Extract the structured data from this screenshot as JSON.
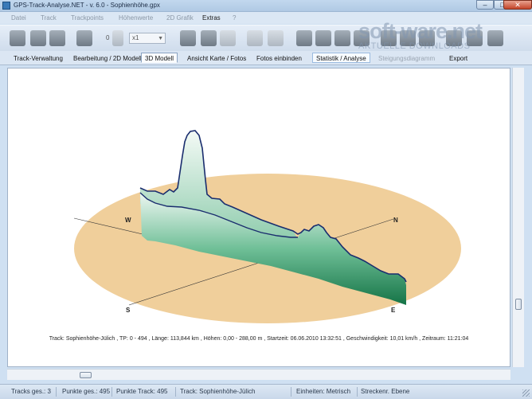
{
  "window": {
    "title": "GPS-Track-Analyse.NET  -  v. 6.0  -  Sophienhöhe.gpx",
    "minimize": "–",
    "maximize": "□",
    "close": "✕"
  },
  "menu": {
    "items": [
      "Datei",
      "Track",
      "Trackpoints",
      "Höhenwerte",
      "2D Grafik",
      "Extras",
      "?"
    ],
    "active": "Extras"
  },
  "toolbar": {
    "counter": "0",
    "zoom_value": "x1"
  },
  "tabs": [
    {
      "label": "Track-Verwaltung"
    },
    {
      "label": "Bearbeitung / 2D Modell"
    },
    {
      "label": "3D Modell"
    },
    {
      "label": "Ansicht Karte / Fotos"
    },
    {
      "label": "Fotos einbinden"
    },
    {
      "label": "Statistik / Analyse"
    },
    {
      "label": "Steigungsdiagramm"
    },
    {
      "label": "Export"
    }
  ],
  "model": {
    "compass": {
      "n": "N",
      "e": "E",
      "s": "S",
      "w": "W"
    },
    "track_info": "Track: Sophienhöhe-Jülich  ,  TP: 0 - 494  ,  Länge: 113,844 km  ,  Höhen: 0,00 - 288,00 m  ,  Startzeit: 06.06.2010 13:32:51  ,  Geschwindigkeit: 10,01 km/h  ,  Zeitraum: 11:21:04",
    "colors": {
      "ground": "#f0cf9b",
      "profile_top": "#e8f3ee",
      "profile_bottom": "#1a7a4c",
      "track_line": "#1a2d6e"
    }
  },
  "watermark": {
    "main": "soft-ware.net",
    "sub": "AKTUELLE DOWNLOADS"
  },
  "status": {
    "tracks": "Tracks ges.: 3",
    "points_total": "Punkte ges.: 495",
    "points_track": "Punkte Track: 495",
    "track": "Track: Sophienhöhe-Jülich",
    "units": "Einheiten: Metrisch",
    "projection": "Streckenr. Ebene"
  }
}
